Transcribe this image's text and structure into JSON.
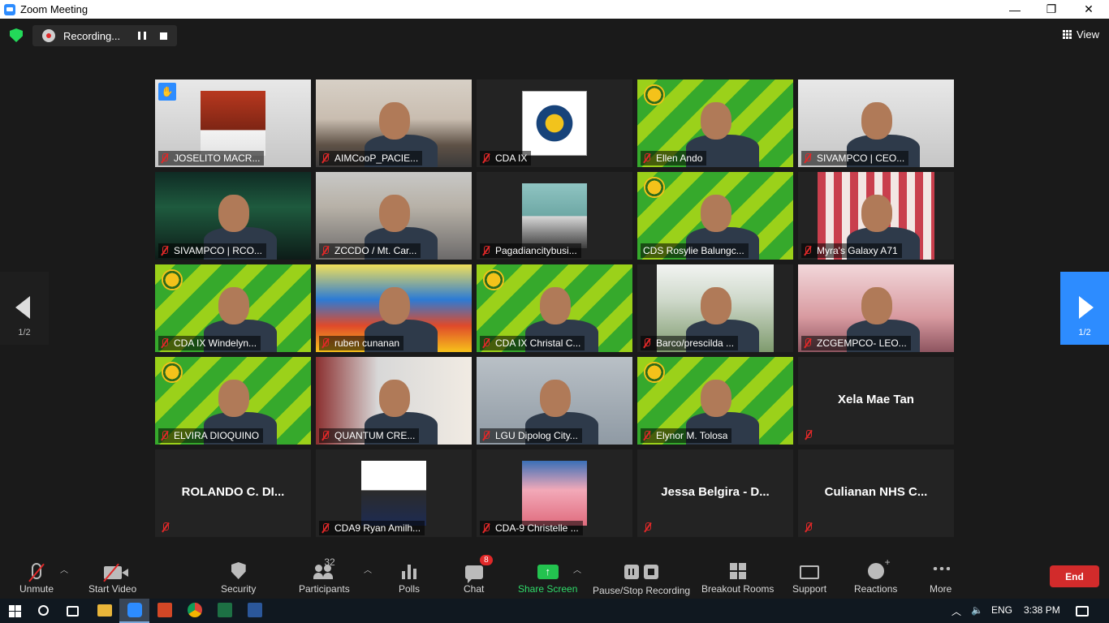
{
  "window": {
    "title": "Zoom Meeting",
    "minimize": "—",
    "restore": "❐",
    "close": "✕"
  },
  "topbar": {
    "recording_label": "Recording...",
    "view_label": "View"
  },
  "participants_grid": [
    {
      "name": "JOSELITO MACR...",
      "type": "video",
      "bg": "white",
      "hand_raised": true,
      "inset": "red"
    },
    {
      "name": "AIMCooP_PACIE...",
      "type": "video",
      "bg": "room"
    },
    {
      "name": "CDA IX",
      "type": "video",
      "bg": "dark",
      "inset": "seal"
    },
    {
      "name": "Ellen Ando",
      "type": "video",
      "bg": "green",
      "active_speaker": true
    },
    {
      "name": "SIVAMPCO | CEO...",
      "type": "video",
      "bg": "white"
    },
    {
      "name": "SIVAMPCO | RCO...",
      "type": "video",
      "bg": "aurora"
    },
    {
      "name": "ZCCDO / Mt. Car...",
      "type": "video",
      "bg": "office"
    },
    {
      "name": "Pagadiancitybusi...",
      "type": "video",
      "bg": "dark",
      "inset": "teal"
    },
    {
      "name": "CDS Rosylie Balungc...",
      "type": "video",
      "bg": "green",
      "muted": false
    },
    {
      "name": "Myra's Galaxy A71",
      "type": "video",
      "bg": "dark",
      "inset": "curtain"
    },
    {
      "name": "CDA IX Windelyn...",
      "type": "video",
      "bg": "green"
    },
    {
      "name": "ruben cunanan",
      "type": "video",
      "bg": "banner"
    },
    {
      "name": "CDA IX Christal C...",
      "type": "video",
      "bg": "green"
    },
    {
      "name": "Barco/prescilda ...",
      "type": "video",
      "bg": "dark",
      "inset": "beach"
    },
    {
      "name": "ZCGEMPCO- LEO...",
      "type": "video",
      "bg": "pink"
    },
    {
      "name": "ELVIRA DIOQUINO",
      "type": "video",
      "bg": "green"
    },
    {
      "name": "QUANTUM CRE...",
      "type": "video",
      "bg": "gym"
    },
    {
      "name": "LGU Dipolog City...",
      "type": "video",
      "bg": "wall"
    },
    {
      "name": "Elynor M. Tolosa",
      "type": "video",
      "bg": "green"
    },
    {
      "name": "Xela Mae Tan",
      "type": "name_only"
    },
    {
      "name": "ROLANDO C. DI...",
      "type": "name_only"
    },
    {
      "name": "CDA9 Ryan Amilh...",
      "type": "video",
      "bg": "dark",
      "inset": "id"
    },
    {
      "name": "CDA-9 Christelle ...",
      "type": "video",
      "bg": "dark",
      "inset": "cafe"
    },
    {
      "name": "Jessa Belgira - D...",
      "type": "name_only"
    },
    {
      "name": "Culianan NHS C...",
      "type": "name_only"
    }
  ],
  "pagination": {
    "left_page": "1/2",
    "right_page": "1/2"
  },
  "toolbar": {
    "unmute": "Unmute",
    "start_video": "Start Video",
    "security": "Security",
    "participants": "Participants",
    "participants_count": "32",
    "polls": "Polls",
    "chat": "Chat",
    "chat_badge": "8",
    "share_screen": "Share Screen",
    "pause_stop_recording": "Pause/Stop Recording",
    "breakout_rooms": "Breakout Rooms",
    "support": "Support",
    "reactions": "Reactions",
    "more": "More",
    "end": "End"
  },
  "taskbar": {
    "language": "ENG",
    "time": "3:38 PM"
  },
  "colors": {
    "accent": "#2d8cff",
    "active_outline": "#e6e62a",
    "end_button": "#d22b2b",
    "share_green": "#23c34f"
  }
}
